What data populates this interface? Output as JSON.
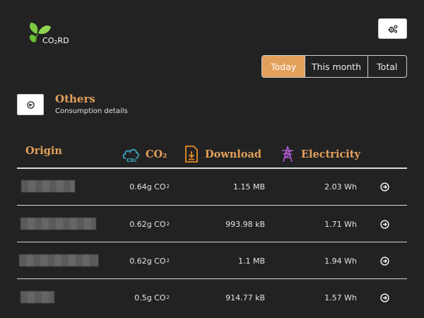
{
  "app": {
    "logo_text": "CO",
    "logo_sub": "2",
    "logo_suffix": "RD"
  },
  "period": {
    "options": [
      {
        "label": "Today",
        "active": true
      },
      {
        "label": "This month",
        "active": false
      },
      {
        "label": "Total",
        "active": false
      }
    ]
  },
  "section": {
    "title": "Others",
    "subtitle": "Consumption details"
  },
  "table": {
    "headers": {
      "origin": "Origin",
      "co2": "CO₂",
      "download": "Download",
      "electricity": "Electricity"
    },
    "co2_unit": "g CO",
    "co2_sub": "2",
    "rows": [
      {
        "co2": "0.64",
        "download": "1.15 MB",
        "electricity": "2.03 Wh"
      },
      {
        "co2": "0.62",
        "download": "993.98 kB",
        "electricity": "1.71 Wh"
      },
      {
        "co2": "0.62",
        "download": "1.1 MB",
        "electricity": "1.94 Wh"
      },
      {
        "co2": "0.5",
        "download": "914.77 kB",
        "electricity": "1.57 Wh"
      }
    ]
  },
  "colors": {
    "accent": "#e3a05b",
    "co2_icon": "#3fb8d8",
    "download_icon": "#e58a2a",
    "electricity_icon": "#b05ad0",
    "leaf": "#7ac943"
  },
  "icons": {
    "settings": "gears-icon",
    "back": "circle-arrow-left-icon",
    "row_action": "circle-arrow-right-icon"
  }
}
